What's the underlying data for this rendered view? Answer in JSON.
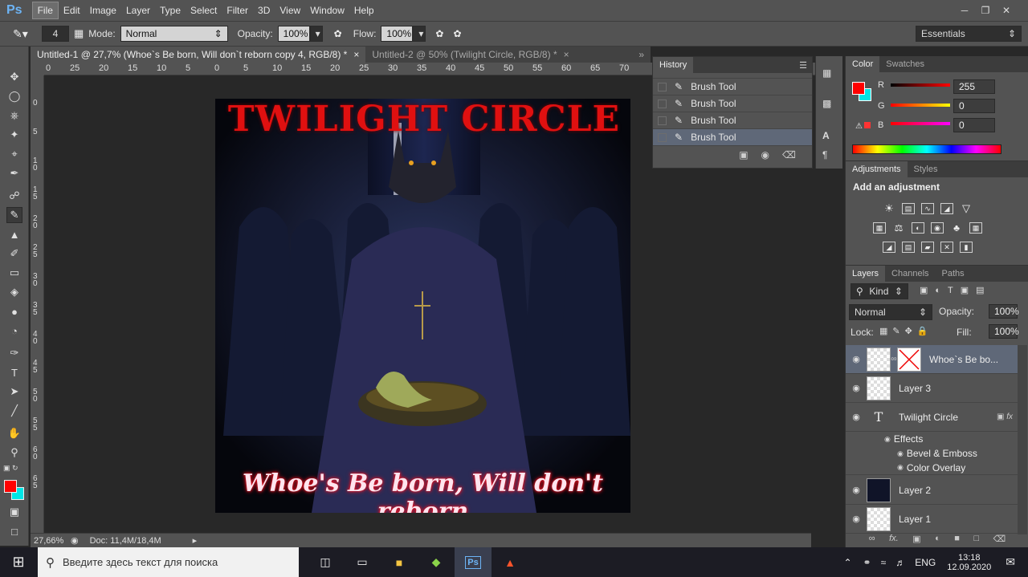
{
  "app": {
    "logo": "Ps"
  },
  "menu": [
    "File",
    "Edit",
    "Image",
    "Layer",
    "Type",
    "Select",
    "Filter",
    "3D",
    "View",
    "Window",
    "Help"
  ],
  "options": {
    "brush_size": "4",
    "mode_label": "Mode:",
    "mode_value": "Normal",
    "opacity_label": "Opacity:",
    "opacity_value": "100%",
    "flow_label": "Flow:",
    "flow_value": "100%",
    "workspace": "Essentials"
  },
  "tabs": [
    {
      "label": "Untitled-1 @ 27,7% (Whoe`s Be born, Will don`t reborn copy 4, RGB/8) *"
    },
    {
      "label": "Untitled-2 @ 50% (Twilight Circle, RGB/8) *"
    }
  ],
  "ruler_h": [
    "0",
    "25",
    "20",
    "15",
    "10",
    "5",
    "0",
    "5",
    "10",
    "15",
    "20",
    "25",
    "30",
    "35",
    "40",
    "45",
    "50",
    "55",
    "60",
    "65",
    "70"
  ],
  "ruler_v": [
    "0",
    "5",
    "1 0",
    "1 5",
    "2 0",
    "2 5",
    "3 0",
    "3 5",
    "4 0",
    "4 5",
    "5 0",
    "5 5",
    "6 0",
    "6 5"
  ],
  "document": {
    "title_art": "TWILIGHT CIRCLE",
    "subtitle_art": "Whoe's Be born, Will don't reborn"
  },
  "status": {
    "zoom": "27,66%",
    "doc": "Doc: 11,4M/18,4M"
  },
  "history": {
    "title": "History",
    "items": [
      "Brush Tool",
      "Brush Tool",
      "Brush Tool",
      "Brush Tool",
      "Brush Tool"
    ]
  },
  "color_panel": {
    "tab_color": "Color",
    "tab_swatches": "Swatches",
    "r_label": "R",
    "r_value": "255",
    "g_label": "G",
    "g_value": "0",
    "b_label": "B",
    "b_value": "0",
    "foreground": "#ff0000",
    "background": "#00e5e5"
  },
  "adjustments": {
    "tab_adjustments": "Adjustments",
    "tab_styles": "Styles",
    "heading": "Add an adjustment"
  },
  "layers_panel": {
    "tab_layers": "Layers",
    "tab_channels": "Channels",
    "tab_paths": "Paths",
    "filter": "Kind",
    "blend": "Normal",
    "opacity_label": "Opacity:",
    "opacity_value": "100%",
    "lock_label": "Lock:",
    "fill_label": "Fill:",
    "fill_value": "100%",
    "layers": [
      "Whoe`s Be bo...",
      "Layer 3",
      "Twilight Circle",
      "Layer 2",
      "Layer 1"
    ],
    "effects_label": "Effects",
    "effects": [
      "Bevel & Emboss",
      "Color Overlay"
    ]
  },
  "taskbar": {
    "search_placeholder": "Введите здесь текст для поиска",
    "lang": "ENG",
    "time": "13:18",
    "date": "12.09.2020"
  }
}
